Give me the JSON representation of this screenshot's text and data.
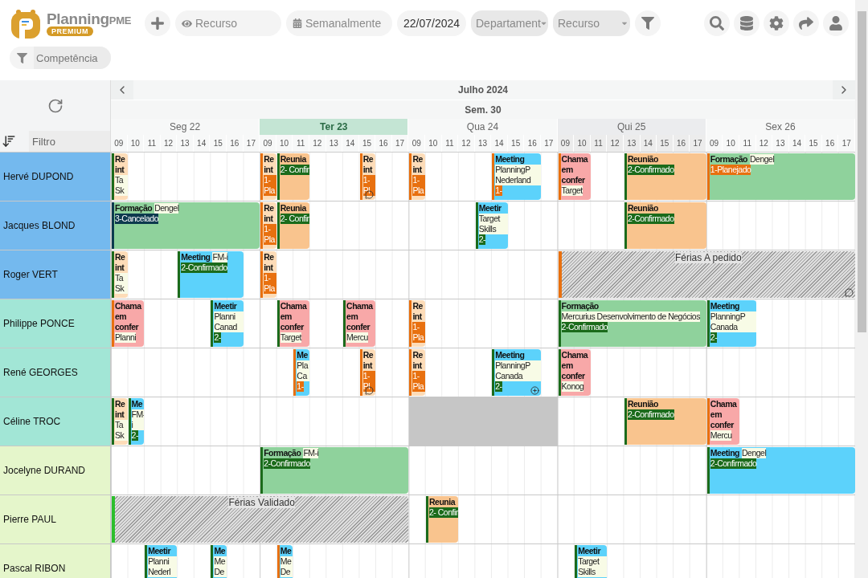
{
  "app": {
    "logo_name": "Planning",
    "logo_suffix": "PME",
    "badge": "PREMIUM"
  },
  "toolbar": {
    "view": "Recurso",
    "period": "Semanalmente",
    "date": "22/07/2024",
    "department": "Departament",
    "resource": "Recurso",
    "skill": "Competência"
  },
  "calendar": {
    "month": "Julho 2024",
    "week": "Sem. 30",
    "filter_placeholder": "Filtro",
    "days": [
      {
        "label": "Seg 22",
        "selected": false,
        "shaded": false,
        "hours": [
          "09",
          "10",
          "11",
          "12",
          "13",
          "14",
          "15",
          "16",
          "17"
        ]
      },
      {
        "label": "Ter 23",
        "selected": true,
        "shaded": false,
        "hours": [
          "09",
          "10",
          "11",
          "12",
          "13",
          "14",
          "15",
          "16",
          "17"
        ]
      },
      {
        "label": "Qua 24",
        "selected": false,
        "shaded": false,
        "hours": [
          "09",
          "10",
          "11",
          "12",
          "13",
          "14",
          "15",
          "16",
          "17"
        ]
      },
      {
        "label": "Qui 25",
        "selected": false,
        "shaded": true,
        "hours": [
          "09",
          "10",
          "11",
          "12",
          "13",
          "14",
          "15",
          "16",
          "17"
        ]
      },
      {
        "label": "Sex 26",
        "selected": false,
        "shaded": false,
        "hours": [
          "09",
          "10",
          "11",
          "12",
          "13",
          "14",
          "15",
          "16",
          "17"
        ]
      }
    ]
  },
  "resources": [
    {
      "name": "Hervé DUPOND",
      "color": "#74b9ee",
      "events": [
        {
          "kind": "confirmed",
          "color": "#fddcb8",
          "title": "Re int",
          "client": "Ta Sk"
        },
        {
          "kind": "planned",
          "color": "#fddcb8",
          "title": "Re int",
          "status": "1- Pla"
        },
        {
          "kind": "confirmed",
          "color": "#f9c48e",
          "title": "Reunia",
          "status": "2- Confir"
        },
        {
          "kind": "planned",
          "color": "#fddcb8",
          "title": "Re int",
          "status": "1- Pl"
        },
        {
          "kind": "planned",
          "color": "#fddcb8",
          "title": "Re int",
          "status": "1- Pla"
        },
        {
          "kind": "planned",
          "color": "#5cd2fb",
          "title": "Meeting",
          "client": "PlanningP Nederland",
          "status": "1-"
        },
        {
          "kind": "planned",
          "color": "#f8a8a8",
          "title": "Chama em confer",
          "client": "Target"
        },
        {
          "kind": "confirmed",
          "color": "#f9c48e",
          "title": "Reunião",
          "status": "2-Confirmado"
        },
        {
          "kind": "planned",
          "color": "#8fd29c",
          "title": "Formação",
          "client": "Dengel",
          "status": "1-Planejado"
        }
      ]
    },
    {
      "name": "Jacques BLOND",
      "color": "#74b9ee",
      "events": [
        {
          "kind": "cancelled",
          "color": "#8fd29c",
          "title": "Formação",
          "client": "Dengel",
          "status": "3-Cancelado"
        },
        {
          "kind": "planned",
          "color": "#fddcb8",
          "title": "Re int",
          "status": "1- Pla"
        },
        {
          "kind": "confirmed",
          "color": "#f9c48e",
          "title": "Reunia",
          "status": "2- Confir"
        },
        {
          "kind": "confirmed",
          "color": "#5cd2fb",
          "title": "Meetir",
          "client": "Target Skills",
          "status": "2-"
        },
        {
          "kind": "confirmed",
          "color": "#f9c48e",
          "title": "Reunião",
          "status": "2-Confirmado"
        }
      ]
    },
    {
      "name": "Roger VERT",
      "color": "#74b9ee",
      "events": [
        {
          "kind": "confirmed",
          "color": "#fddcb8",
          "title": "Re int",
          "client": "Ta Sk"
        },
        {
          "kind": "confirmed",
          "color": "#5cd2fb",
          "title": "Meeting",
          "client": "FM-i",
          "status": "2-Confirmado"
        },
        {
          "kind": "planned",
          "color": "#fddcb8",
          "title": "Re int",
          "status": "1- Pla"
        },
        {
          "kind": "absence",
          "color": "#e8700f",
          "title": "Férias A pedido"
        }
      ]
    },
    {
      "name": "Philippe PONCE",
      "color": "#a2e6d6",
      "events": [
        {
          "kind": "planned",
          "color": "#f8a8a8",
          "title": "Chama em confer",
          "client": "Planni"
        },
        {
          "kind": "confirmed",
          "color": "#5cd2fb",
          "title": "Meetir",
          "client": "Planni Canad",
          "status": "2-"
        },
        {
          "kind": "confirmed",
          "color": "#f8a8a8",
          "title": "Chama em confer",
          "client": "Target"
        },
        {
          "kind": "confirmed",
          "color": "#f8a8a8",
          "title": "Chama em confer",
          "client": "Mercu"
        },
        {
          "kind": "planned",
          "color": "#fddcb8",
          "title": "Re int",
          "status": "1- Pla"
        },
        {
          "kind": "confirmed",
          "color": "#8fd29c",
          "title": "Formação",
          "client": "Mercurius Desenvolvimento de Negócios",
          "status": "2-Confirmado"
        },
        {
          "kind": "confirmed",
          "color": "#5cd2fb",
          "title": "Meeting",
          "client": "PlanningP Canada",
          "status": "2-"
        }
      ]
    },
    {
      "name": "René GEORGES",
      "color": "#a2e6d6",
      "events": [
        {
          "kind": "planned",
          "color": "#5cd2fb",
          "title": "Me",
          "client": "Pla Ca",
          "status": "1-"
        },
        {
          "kind": "planned",
          "color": "#fddcb8",
          "title": "Re int",
          "status": "1- Pl"
        },
        {
          "kind": "planned",
          "color": "#fddcb8",
          "title": "Re int",
          "status": "1- Pla"
        },
        {
          "kind": "confirmed",
          "color": "#5cd2fb",
          "title": "Meeting",
          "client": "PlanningP Canada",
          "status": "2-"
        },
        {
          "kind": "confirmed",
          "color": "#f8a8a8",
          "title": "Chama em confer",
          "client": "Konog"
        }
      ]
    },
    {
      "name": "Céline TROC",
      "color": "#a2e6d6",
      "events": [
        {
          "kind": "confirmed",
          "color": "#fddcb8",
          "title": "Re int",
          "client": "Ta Sk"
        },
        {
          "kind": "confirmed",
          "color": "#5cd2fb",
          "title": "Me",
          "client": "FM-i",
          "status": "2-"
        },
        {
          "kind": "unavailable"
        },
        {
          "kind": "confirmed",
          "color": "#f9c48e",
          "title": "Reunião",
          "status": "2-Confirmado"
        },
        {
          "kind": "planned",
          "color": "#f8a8a8",
          "title": "Chama em confer",
          "client": "Mercu"
        }
      ]
    },
    {
      "name": "Jocelyne DURAND",
      "color": "#e5f6cb",
      "events": [
        {
          "kind": "confirmed",
          "color": "#8fd29c",
          "title": "Formação",
          "client": "FM-i",
          "status": "2-Confirmado"
        },
        {
          "kind": "confirmed",
          "color": "#5cd2fb",
          "title": "Meeting",
          "client": "Dengel",
          "status": "2-Confirmado"
        }
      ]
    },
    {
      "name": "Pierre PAUL",
      "color": "#e5f6cb",
      "events": [
        {
          "kind": "absence",
          "color": "#2cbf2c",
          "title": "Férias Validado"
        },
        {
          "kind": "confirmed",
          "color": "#f9c48e",
          "title": "Reunia",
          "status": "2- Confir"
        }
      ]
    },
    {
      "name": "Pascal RIBON",
      "color": "#e5f6cb",
      "events": [
        {
          "kind": "confirmed",
          "color": "#5cd2fb",
          "title": "Meetir",
          "client": "Planni Nederl"
        },
        {
          "kind": "confirmed",
          "color": "#5cd2fb",
          "title": "Me",
          "client": "Me De"
        },
        {
          "kind": "planned",
          "color": "#5cd2fb",
          "title": "Me",
          "client": "Me De"
        },
        {
          "kind": "confirmed",
          "color": "#5cd2fb",
          "title": "Meetir",
          "client": "Target Skills"
        }
      ]
    }
  ]
}
